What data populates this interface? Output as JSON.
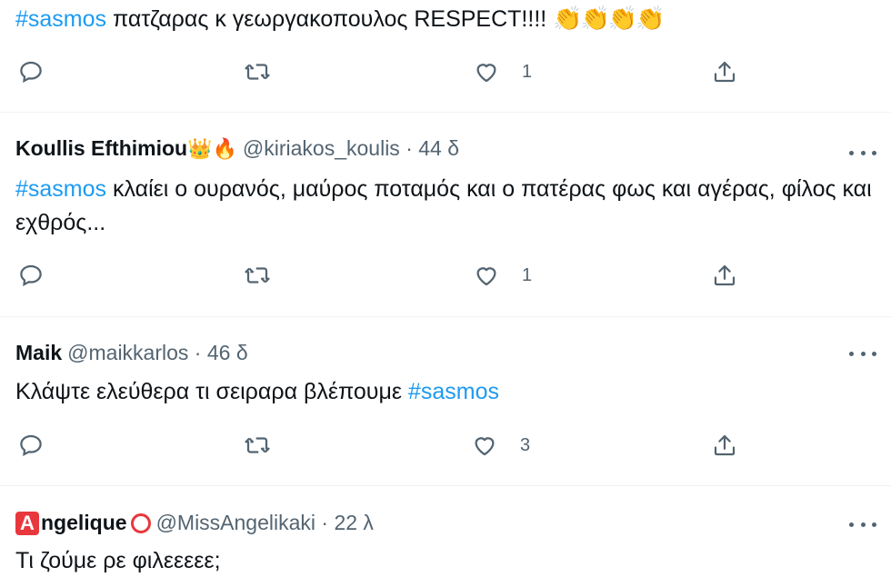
{
  "tweets": [
    {
      "text_parts": [
        "#sasmos",
        " πατζαρας κ γεωργακοπουλος RESPECT!!!! ",
        "👏👏👏👏"
      ],
      "likes": "1"
    },
    {
      "name": "Koullis Efthimiou",
      "emoji": "👑🔥",
      "handle": "@kiriakos_koulis · 44 δ",
      "text_parts": [
        "#sasmos",
        " κλαίει ο ουρανός, μαύρος ποταμός και ο πατέρας φως και αγέρας, φίλος και εχθρός..."
      ],
      "likes": "1"
    },
    {
      "name": "Maik",
      "handle": "@maikkarlos · 46 δ",
      "text_parts": [
        "Κλάψτε ελεύθερα τι σειραρα βλέπουμε ",
        "#sasmos"
      ],
      "likes": "3"
    },
    {
      "name_badge": "A",
      "name": "ngelique",
      "handle": "@MissAngelikaki · 22 λ",
      "text_parts": [
        "Τι ζούμε ρε φιλεεεεε;"
      ]
    }
  ],
  "icons": {
    "reply": "reply-icon",
    "retweet": "retweet-icon",
    "like": "heart-icon",
    "share": "share-icon",
    "more": "more-icon"
  },
  "colors": {
    "hashtag": "#1d9bf0",
    "secondary": "#536471",
    "badge": "#e8383d"
  }
}
